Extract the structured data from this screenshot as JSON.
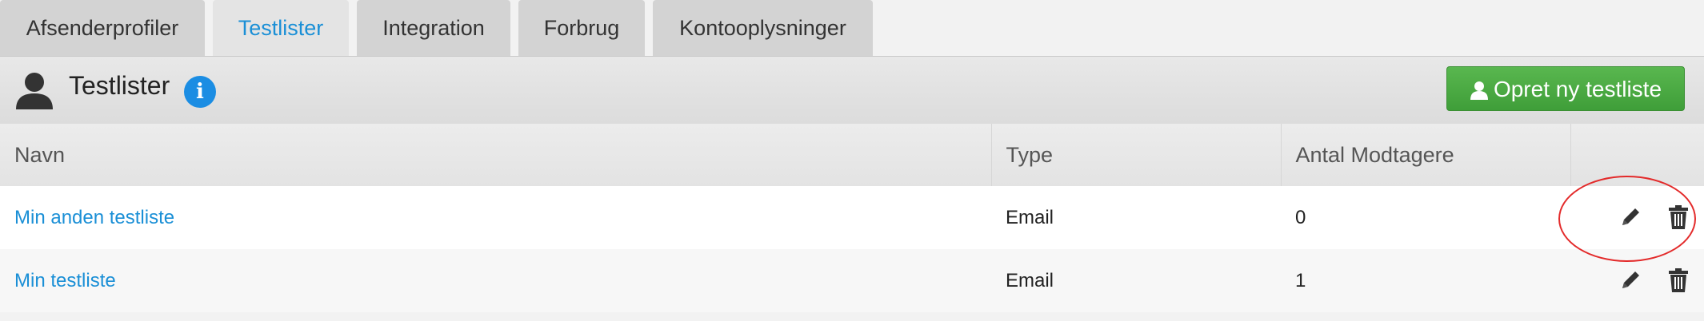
{
  "tabs": [
    {
      "label": "Afsenderprofiler",
      "active": false
    },
    {
      "label": "Testlister",
      "active": true
    },
    {
      "label": "Integration",
      "active": false
    },
    {
      "label": "Forbrug",
      "active": false
    },
    {
      "label": "Kontooplysninger",
      "active": false
    }
  ],
  "header": {
    "title": "Testlister",
    "title_icon": "user-icon",
    "info_icon": "info-icon",
    "create_button": "Opret ny testliste",
    "create_button_icon": "user-icon",
    "create_button_color": "#4cae45"
  },
  "table": {
    "columns": [
      "Navn",
      "Type",
      "Antal Modtagere",
      ""
    ],
    "rows": [
      {
        "name": "Min anden testliste",
        "type": "Email",
        "count": "0",
        "actions": [
          "pencil-icon",
          "trash-icon"
        ]
      },
      {
        "name": "Min testliste",
        "type": "Email",
        "count": "1",
        "actions": [
          "pencil-icon",
          "trash-icon"
        ]
      }
    ]
  },
  "colors": {
    "accent": "#1a8fd6",
    "highlight": "#e32a2a"
  }
}
